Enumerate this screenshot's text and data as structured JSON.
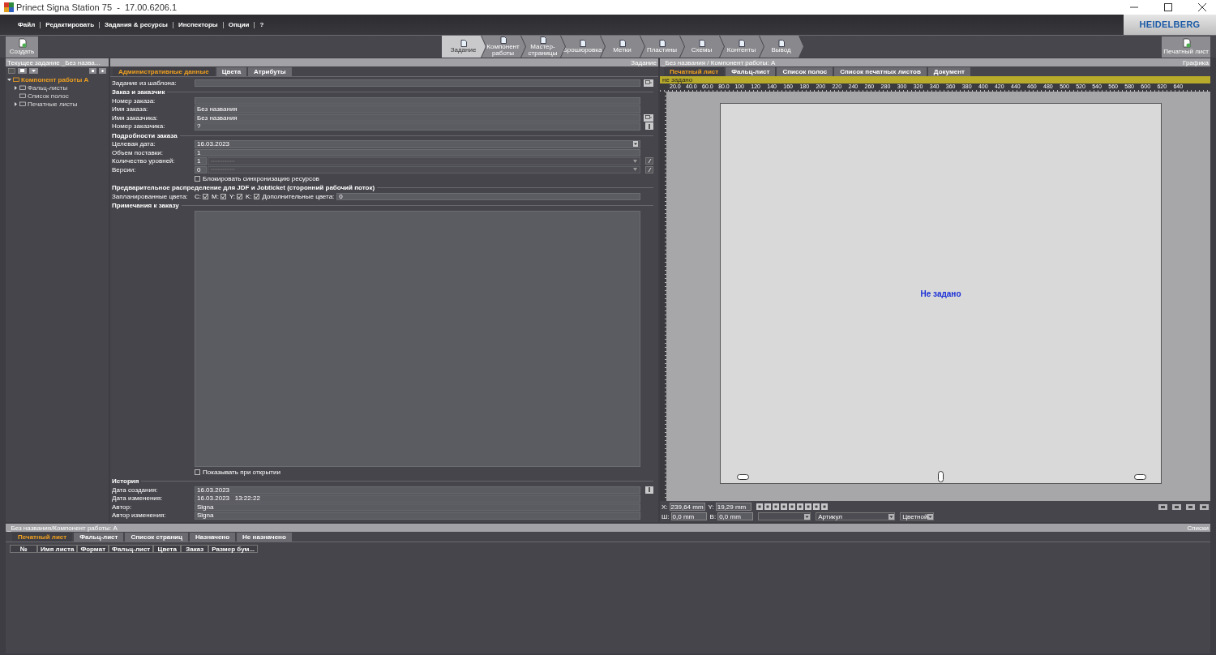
{
  "window": {
    "title": "Prinect Signa Station 75  -  17.00.6206.1"
  },
  "menu": [
    "Файл",
    "Редактировать",
    "Задания & ресурсы",
    "Инспекторы",
    "Опции",
    "?"
  ],
  "logo": "HEIDELBERG",
  "toolbar": {
    "create": "Создать",
    "sheet": "Печатный лист",
    "steps": [
      {
        "label": "Задание",
        "selected": true
      },
      {
        "label": "Компонент работы",
        "selected": false
      },
      {
        "label": "Мастер-страницы",
        "selected": false
      },
      {
        "label": "Брошюровка",
        "selected": false
      },
      {
        "label": "Метки",
        "selected": false
      },
      {
        "label": "Пластины",
        "selected": false
      },
      {
        "label": "Схемы",
        "selected": false
      },
      {
        "label": "Контенты",
        "selected": false
      },
      {
        "label": "Вывод",
        "selected": false
      }
    ]
  },
  "job_panel": {
    "title": "Текущее задание _Без назва...",
    "tree": [
      {
        "label": "Компонент работы A",
        "expanded": true,
        "children": [
          {
            "label": "Фальц-листы",
            "expanded": false
          },
          {
            "label": "Список полос"
          },
          {
            "label": "Печатные листы",
            "expanded": false
          }
        ]
      }
    ]
  },
  "form_panel": {
    "title": "Задание",
    "tabs": [
      {
        "label": "Административные данные",
        "selected": true
      },
      {
        "label": "Цвета",
        "selected": false
      },
      {
        "label": "Атрибуты",
        "selected": false
      }
    ],
    "rows": [
      {
        "kind": "text_field",
        "label": "Задание из шаблона:",
        "button": {
          "kind": "browse"
        }
      },
      {
        "kind": "section",
        "label": "Заказ и заказчик"
      },
      {
        "kind": "text_field",
        "label": "Номер заказа:"
      },
      {
        "kind": "text_field",
        "label": "Имя заказа:",
        "value": "Без названия"
      },
      {
        "kind": "text_field",
        "label": "Имя заказчика:",
        "value": "Без названия",
        "button": {
          "kind": "browse"
        }
      },
      {
        "kind": "text_field",
        "label": "Номер заказчика:",
        "value": "?",
        "button": {
          "kind": "info"
        }
      },
      {
        "kind": "section",
        "label": "Подробности заказа"
      },
      {
        "kind": "date_field",
        "label": "Целевая дата:",
        "value": "16.03.2023"
      },
      {
        "kind": "text_field",
        "label": "Объем поставки:",
        "value": "1"
      },
      {
        "kind": "count_field",
        "label": "Количество уровней:",
        "value": "1",
        "button": {
          "kind": "edit"
        }
      },
      {
        "kind": "count_field",
        "label": "Версии:",
        "value": "0",
        "button": {
          "kind": "edit"
        }
      },
      {
        "kind": "checkbox",
        "label": "Блокировать синхронизацию ресурсов",
        "checked": false
      },
      {
        "kind": "section",
        "label": "Предварительное распределение для JDF и Jobticket (сторонний рабочий поток)"
      },
      {
        "kind": "colors",
        "label": "Запланированные цвета:",
        "inks": [
          {
            "label": "C:",
            "checked": true
          },
          {
            "label": "M:",
            "checked": true
          },
          {
            "label": "Y:",
            "checked": true
          },
          {
            "label": "K:",
            "checked": true
          }
        ],
        "extra_label": "Дополнительные цвета:",
        "extra_value": "0"
      },
      {
        "kind": "section",
        "label": "Примечания к заказу"
      },
      {
        "kind": "notes"
      },
      {
        "kind": "checkbox",
        "label": "Показывать при открытии",
        "checked": false
      },
      {
        "kind": "section",
        "label": "История"
      },
      {
        "kind": "text_field",
        "label": "Дата создания:",
        "value": "16.03.2023",
        "button": {
          "kind": "info"
        }
      },
      {
        "kind": "text_field",
        "label": "Дата изменения:",
        "value": "16.03.2023   13:22:22"
      },
      {
        "kind": "text_field",
        "label": "Автор:",
        "value": "Signa"
      },
      {
        "kind": "text_field",
        "label": "Автор изменения:",
        "value": "Signa"
      }
    ]
  },
  "graphics_panel": {
    "title": "_Без названия / Компонент работы: A",
    "side_title": "Графика",
    "tabs": [
      {
        "label": "Печатный лист",
        "selected": true
      },
      {
        "label": "Фальц-лист",
        "selected": false
      },
      {
        "label": "Список полос",
        "selected": false
      },
      {
        "label": "Список печатных листов",
        "selected": false
      },
      {
        "label": "Документ",
        "selected": false
      }
    ],
    "status": "не задано",
    "ruler": [
      "20.0",
      "40.0",
      "60.0",
      "80.0",
      "100",
      "120",
      "140",
      "160",
      "180",
      "200",
      "220",
      "240",
      "260",
      "280",
      "300",
      "320",
      "340",
      "360",
      "380",
      "400",
      "420",
      "440",
      "460",
      "480",
      "500",
      "520",
      "540",
      "560",
      "580",
      "600",
      "620",
      "640"
    ],
    "sheet_label": "Не задано",
    "x_label": "X:",
    "x": "239,64 mm",
    "y_label": "Y:",
    "y": "19,29 mm",
    "w_label": "Ш:",
    "w": "0,0 mm",
    "h_label": "В:",
    "h": "0,0 mm",
    "dropdowns": [
      {
        "kind": "empty"
      },
      {
        "kind": "filled",
        "value": "Артикул"
      },
      {
        "kind": "filled",
        "value": "Цветной"
      }
    ]
  },
  "lists_panel": {
    "title": "_Без названия/Компонент работы: A",
    "side_title": "Списки",
    "tabs": [
      {
        "label": "Печатный лист",
        "selected": true
      },
      {
        "label": "Фальц-лист",
        "selected": false
      },
      {
        "label": "Список страниц",
        "selected": false
      },
      {
        "label": "Назначено",
        "selected": false
      },
      {
        "label": "Не назначено",
        "selected": false
      }
    ],
    "columns": [
      "№",
      "Имя листа",
      "Формат",
      "Фальц-лист",
      "Цвета",
      "Заказ",
      "Размер бум..."
    ]
  }
}
